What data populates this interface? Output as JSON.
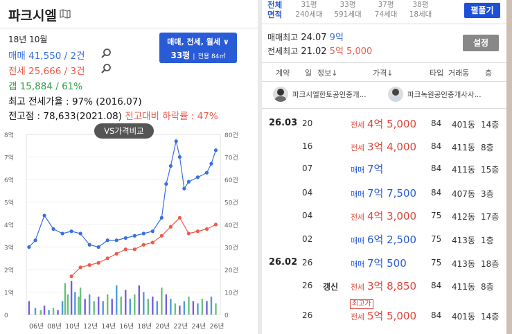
{
  "left": {
    "title": "파크시엘",
    "as_of": "18년 10월",
    "sale": "매매 41,550 / 2건",
    "jeonse": "전세 25,666 / 3건",
    "gap": "갭   15,884 / 61%",
    "max_ratio": "최고 전세가율 : 97% (2016.07)",
    "peak_prefix": "전고점 : 78,633(2021.08) ",
    "peak_drop": "전고대비 하락률 : 47%",
    "period_button_line1": "매매, 전세, 월세 ∨",
    "period_button_py": "33평",
    "period_button_sub": "전용 84㎡",
    "vs_compare": "VS가격비교",
    "colors": {
      "sale": "#3a6fe0",
      "jeonse": "#ef5a4a",
      "gap": "#2ea043"
    }
  },
  "chart_data": {
    "type": "line",
    "x_ticks": [
      "06년",
      "08년",
      "10년",
      "12년",
      "14년",
      "16년",
      "18년",
      "20년",
      "22년",
      "24년",
      "26년"
    ],
    "y_left_ticks": [
      "8억",
      "7억",
      "6억",
      "5억",
      "4억",
      "3억",
      "2억",
      "1억",
      "0"
    ],
    "y_right_ticks": [
      "80건",
      "70건",
      "60건",
      "50건",
      "40건",
      "30건",
      "20건",
      "10건",
      "0"
    ],
    "ylim_left": [
      0,
      8
    ],
    "ylim_right": [
      0,
      80
    ],
    "series": [
      {
        "name": "매매",
        "color": "#3a6fe0",
        "x": [
          2005.3,
          2006,
          2007,
          2008,
          2009,
          2010,
          2011,
          2012,
          2013,
          2014,
          2015,
          2016,
          2017,
          2018,
          2019,
          2020,
          2020.5,
          2021,
          2021.6,
          2022,
          2022.5,
          2023,
          2024,
          2025,
          2025.5,
          2026
        ],
        "y": [
          3.0,
          3.3,
          4.4,
          3.8,
          3.6,
          3.7,
          3.6,
          3.1,
          3.0,
          3.3,
          3.3,
          3.4,
          3.5,
          3.6,
          3.7,
          4.3,
          5.8,
          6.6,
          7.7,
          7.0,
          5.6,
          5.9,
          6.1,
          6.3,
          6.7,
          7.3
        ]
      },
      {
        "name": "전세",
        "color": "#ef5a4a",
        "x": [
          2010,
          2011,
          2012,
          2013,
          2014,
          2015,
          2016,
          2017,
          2018,
          2019,
          2020,
          2021,
          2022,
          2023,
          2024,
          2025,
          2026
        ],
        "y": [
          1.7,
          2.1,
          2.2,
          2.3,
          2.5,
          2.7,
          2.9,
          2.9,
          3.1,
          3.2,
          3.5,
          3.9,
          4.3,
          3.6,
          3.7,
          3.8,
          4.0
        ]
      }
    ],
    "volume": [
      {
        "x": 2005.3,
        "v": 6
      },
      {
        "x": 2006,
        "v": 3
      },
      {
        "x": 2006.6,
        "v": 2
      },
      {
        "x": 2007,
        "v": 4
      },
      {
        "x": 2007.5,
        "v": 2
      },
      {
        "x": 2008,
        "v": 3
      },
      {
        "x": 2008.5,
        "v": 2
      },
      {
        "x": 2009,
        "v": 6
      },
      {
        "x": 2009.3,
        "v": 14
      },
      {
        "x": 2009.6,
        "v": 9
      },
      {
        "x": 2010,
        "v": 15
      },
      {
        "x": 2010.4,
        "v": 10
      },
      {
        "x": 2010.8,
        "v": 8
      },
      {
        "x": 2011,
        "v": 12
      },
      {
        "x": 2011.5,
        "v": 7
      },
      {
        "x": 2012,
        "v": 9
      },
      {
        "x": 2012.5,
        "v": 6
      },
      {
        "x": 2013,
        "v": 8
      },
      {
        "x": 2013.5,
        "v": 6
      },
      {
        "x": 2014,
        "v": 9
      },
      {
        "x": 2014.5,
        "v": 7
      },
      {
        "x": 2015,
        "v": 13
      },
      {
        "x": 2015.5,
        "v": 8
      },
      {
        "x": 2016,
        "v": 11
      },
      {
        "x": 2016.5,
        "v": 7
      },
      {
        "x": 2017,
        "v": 9
      },
      {
        "x": 2017.5,
        "v": 13
      },
      {
        "x": 2018,
        "v": 10
      },
      {
        "x": 2018.5,
        "v": 7
      },
      {
        "x": 2019,
        "v": 8
      },
      {
        "x": 2019.5,
        "v": 6
      },
      {
        "x": 2020,
        "v": 12
      },
      {
        "x": 2020.5,
        "v": 9
      },
      {
        "x": 2021,
        "v": 7
      },
      {
        "x": 2021.5,
        "v": 5
      },
      {
        "x": 2022,
        "v": 4
      },
      {
        "x": 2022.5,
        "v": 6
      },
      {
        "x": 2023,
        "v": 8
      },
      {
        "x": 2023.5,
        "v": 6
      },
      {
        "x": 2024,
        "v": 5
      },
      {
        "x": 2024.5,
        "v": 7
      },
      {
        "x": 2025,
        "v": 6
      },
      {
        "x": 2025.5,
        "v": 8
      },
      {
        "x": 2026,
        "v": 5
      }
    ],
    "grid": true
  },
  "right": {
    "total_label": "전체",
    "area_label": "면적",
    "pyeong": [
      {
        "py": "31평",
        "units": "240세대"
      },
      {
        "py": "33평",
        "units": "591세대"
      },
      {
        "py": "37평",
        "units": "74세대"
      },
      {
        "py": "38평",
        "units": "18세대"
      }
    ],
    "unfold_button": "펼풀기",
    "sale_max_label": "매매최고",
    "sale_max_date": "24.07",
    "sale_max_price": "9억",
    "jeonse_max_label": "전세최고",
    "jeonse_max_date": "21.02",
    "jeonse_max_price": "5억 5,000",
    "settings_button": "설정",
    "headers": {
      "contract": "계약",
      "day": "일",
      "info": "정보↓",
      "price": "가격↓",
      "type": "타입",
      "building": "거래동",
      "floor": "층"
    },
    "agents": [
      "파크시엘한토공인중개...",
      "파크녹원공인중개사사..."
    ],
    "rows": [
      {
        "ym": "26.03",
        "d": "20",
        "info": "",
        "kind": "전세",
        "price": "4억 5,000",
        "area": "84",
        "bld": "401동",
        "fl": "14층",
        "badge": ""
      },
      {
        "ym": "",
        "d": "16",
        "info": "",
        "kind": "전세",
        "price": "3억 4,000",
        "area": "84",
        "bld": "411동",
        "fl": "8층",
        "badge": ""
      },
      {
        "ym": "",
        "d": "07",
        "info": "",
        "kind": "매매",
        "price": "7억",
        "area": "84",
        "bld": "411동",
        "fl": "15층",
        "badge": ""
      },
      {
        "ym": "",
        "d": "04",
        "info": "",
        "kind": "매매",
        "price": "7억 7,500",
        "area": "84",
        "bld": "407동",
        "fl": "3층",
        "badge": ""
      },
      {
        "ym": "",
        "d": "04",
        "info": "",
        "kind": "전세",
        "price": "4억 3,000",
        "area": "75",
        "bld": "412동",
        "fl": "17층",
        "badge": ""
      },
      {
        "ym": "",
        "d": "02",
        "info": "",
        "kind": "매매",
        "price": "6억 2,500",
        "area": "75",
        "bld": "413동",
        "fl": "1층",
        "badge": ""
      },
      {
        "ym": "26.02",
        "d": "26",
        "info": "",
        "kind": "매매",
        "price": "7억 500",
        "area": "75",
        "bld": "413동",
        "fl": "18층",
        "badge": ""
      },
      {
        "ym": "",
        "d": "26",
        "info": "갱신",
        "kind": "전세",
        "price": "3억 8,850",
        "area": "84",
        "bld": "411동",
        "fl": "8층",
        "badge": ""
      },
      {
        "ym": "",
        "d": "26",
        "info": "",
        "kind": "전세",
        "price": "5억 5,000",
        "area": "84",
        "bld": "401동",
        "fl": "14층",
        "badge": "최고가"
      }
    ]
  }
}
